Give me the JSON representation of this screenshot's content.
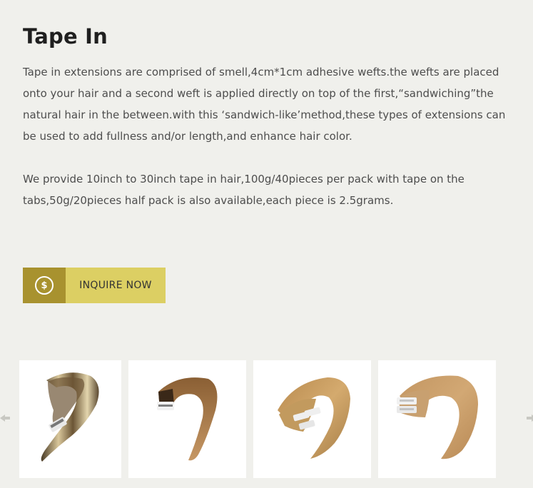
{
  "title": "Tape In",
  "paragraphs": [
    "Tape in extensions are comprised of smell,4cm*1cm adhesive wefts.the wefts are placed onto your hair and a second weft is applied directly on top of the first,“sandwiching”the natural hair in the between.with this ‘sandwich-like’method,these types of extensions can be used to add fullness and/or length,and enhance hair color.",
    "We provide 10inch to 30inch tape in hair,100g/40pieces per pack with tape on the tabs,50g/20pieces half pack is also available,each piece is 2.5grams."
  ],
  "inquire_button": {
    "icon": "dollar-icon",
    "icon_glyph": "$",
    "label": "INQUIRE NOW"
  },
  "carousel": {
    "prev_icon": "arrow-left-icon",
    "next_icon": "arrow-right-icon",
    "thumbnails": [
      {
        "name": "balayage-tape-hair-thumbnail"
      },
      {
        "name": "ombre-tape-hair-thumbnail"
      },
      {
        "name": "honey-blonde-tape-hair-thumbnail"
      },
      {
        "name": "light-brown-tape-hair-thumbnail"
      }
    ]
  },
  "colors": {
    "button_icon_bg": "#a8922f",
    "button_label_bg": "#dccf63",
    "page_bg": "#f0f0ec"
  }
}
